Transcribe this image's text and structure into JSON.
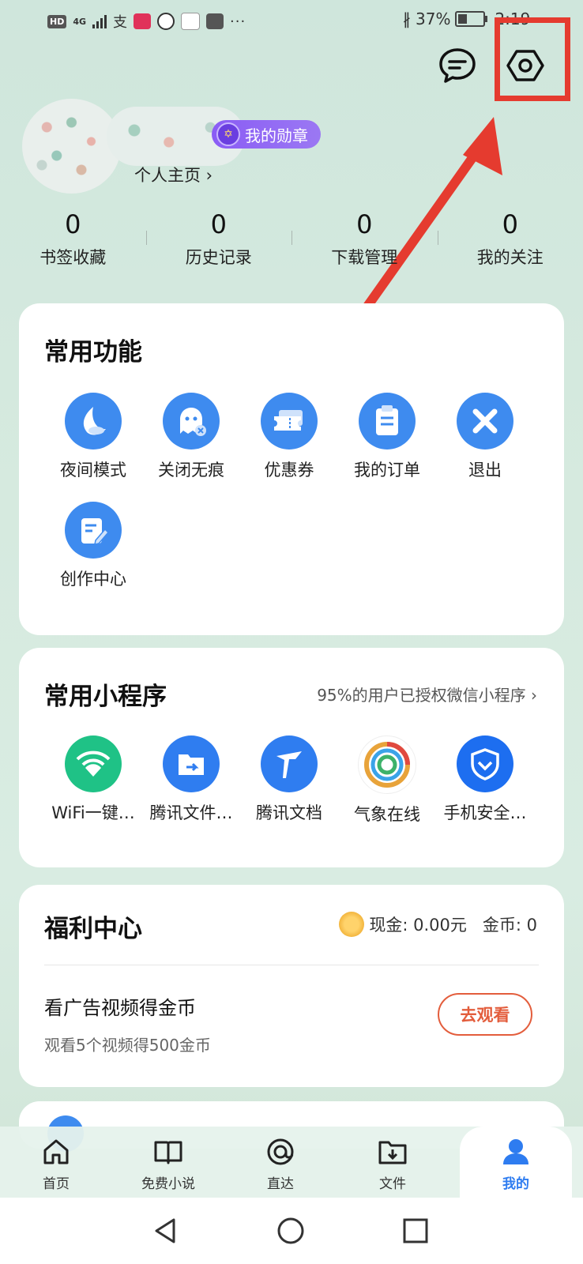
{
  "status_bar": {
    "hd": "HD",
    "network": "4G",
    "battery_percent": "37%",
    "time": "2:19"
  },
  "profile": {
    "medal_label": "我的勋章",
    "home_link": "个人主页 ›"
  },
  "stats": [
    {
      "count": "0",
      "label": "书签收藏"
    },
    {
      "count": "0",
      "label": "历史记录"
    },
    {
      "count": "0",
      "label": "下载管理"
    },
    {
      "count": "0",
      "label": "我的关注"
    }
  ],
  "common_functions": {
    "title": "常用功能",
    "items": [
      {
        "label": "夜间模式",
        "icon": "night-mode-icon"
      },
      {
        "label": "关闭无痕",
        "icon": "incognito-icon"
      },
      {
        "label": "优惠券",
        "icon": "coupon-icon"
      },
      {
        "label": "我的订单",
        "icon": "order-icon"
      },
      {
        "label": "退出",
        "icon": "exit-icon"
      },
      {
        "label": "创作中心",
        "icon": "creator-icon"
      }
    ]
  },
  "mini_programs": {
    "title": "常用小程序",
    "auth_link": "95%的用户已授权微信小程序 ›",
    "items": [
      {
        "label": "WiFi一键…",
        "icon": "wifi-icon",
        "color": "#1fc286"
      },
      {
        "label": "腾讯文件…",
        "icon": "tencent-file-icon",
        "color": "#2f7df0"
      },
      {
        "label": "腾讯文档",
        "icon": "tencent-docs-icon",
        "color": "#2f7df0"
      },
      {
        "label": "气象在线",
        "icon": "weather-icon",
        "color": "#e8a33a"
      },
      {
        "label": "手机安全…",
        "icon": "phone-security-icon",
        "color": "#1d6ef0"
      }
    ]
  },
  "welfare": {
    "title": "福利中心",
    "cash": "现金: 0.00元",
    "coins": "金币: 0",
    "task_title": "看广告视频得金币",
    "task_desc": "观看5个视频得500金币",
    "watch_button": "去观看"
  },
  "bottom_nav": [
    {
      "label": "首页",
      "icon": "home-icon"
    },
    {
      "label": "免费小说",
      "icon": "book-icon"
    },
    {
      "label": "直达",
      "icon": "direct-icon"
    },
    {
      "label": "文件",
      "icon": "folder-icon"
    },
    {
      "label": "我的",
      "icon": "profile-icon",
      "active": true
    }
  ],
  "colors": {
    "accent": "#3e8bef",
    "highlight": "#e53b2f",
    "medal": "#8a5cf5"
  }
}
